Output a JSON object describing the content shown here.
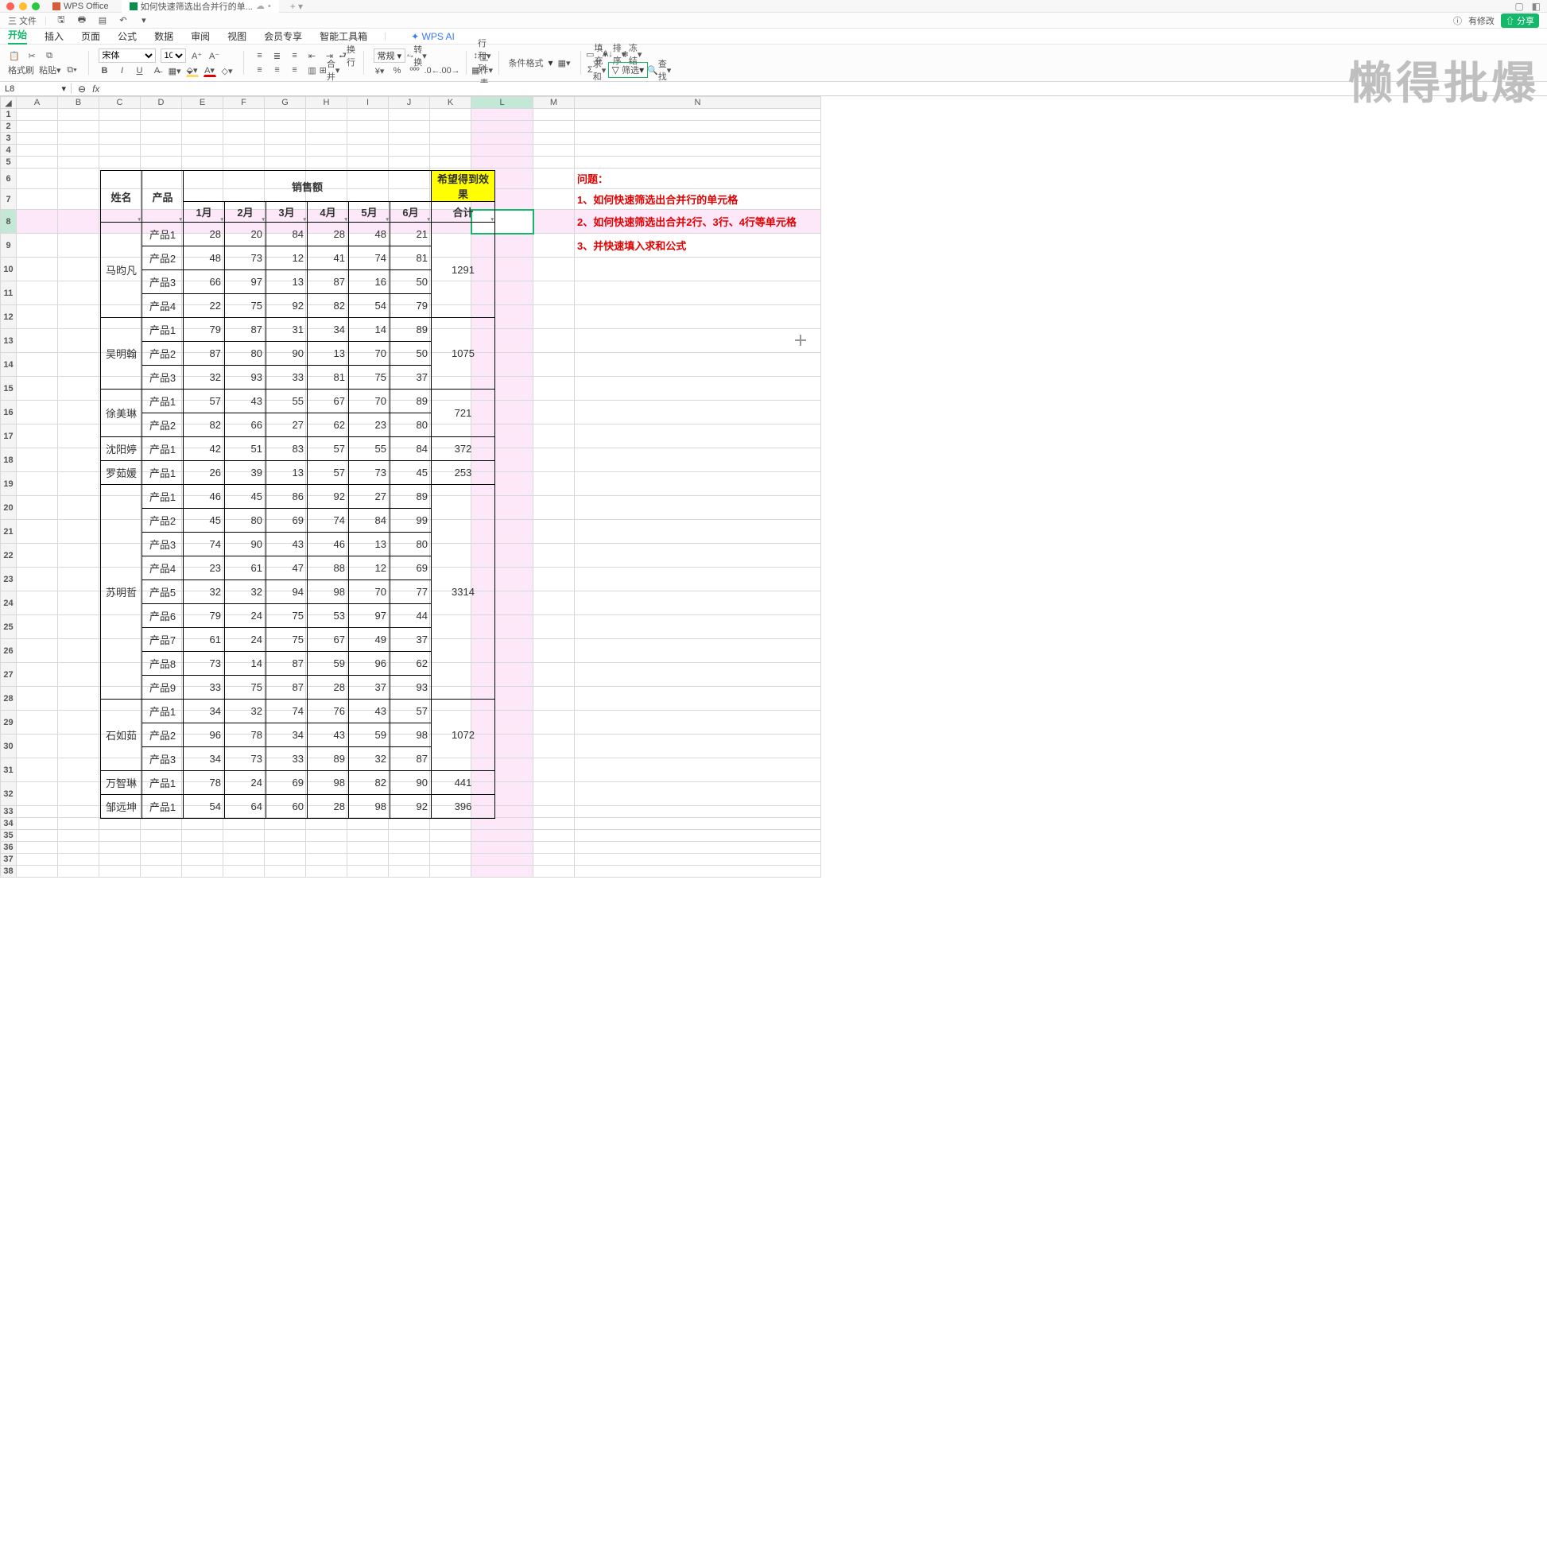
{
  "titlebar": {
    "tab1": "WPS Office",
    "tab2": "如何快速筛选出合并行的单..."
  },
  "filebar": {
    "menu": "三 文件",
    "changes": "有修改",
    "share": "分享"
  },
  "menubar": [
    "开始",
    "插入",
    "页面",
    "公式",
    "数据",
    "审阅",
    "视图",
    "会员专享",
    "智能工具箱"
  ],
  "ai": "WPS AI",
  "ribbon": {
    "fmt_brush": "格式刷",
    "paste": "粘贴",
    "font": "宋体",
    "size": "10",
    "general": "常规",
    "convert": "转换",
    "rowcol": "行和列",
    "sheet": "工作表",
    "cond": "条件格式",
    "fill": "填充",
    "sort": "排序",
    "freeze": "冻结",
    "sum": "求和",
    "filter": "筛选",
    "find": "查找",
    "wrap": "换行",
    "merge": "合并"
  },
  "fbar": {
    "name": "L8",
    "fx": "fx"
  },
  "cols": [
    "A",
    "B",
    "C",
    "D",
    "E",
    "F",
    "G",
    "H",
    "I",
    "J",
    "K",
    "L",
    "M",
    "N"
  ],
  "headers": {
    "name": "姓名",
    "product": "产品",
    "sales": "销售额",
    "expect": "希望得到效果",
    "m1": "1月",
    "m2": "2月",
    "m3": "3月",
    "m4": "4月",
    "m5": "5月",
    "m6": "6月",
    "total": "合计"
  },
  "notes": {
    "title": "问题：",
    "l1": "1、如何快速筛选出合并行的单元格",
    "l2": "2、如何快速筛选出合并2行、3行、4行等单元格",
    "l3": "3、并快速填入求和公式"
  },
  "watermark": "懒得批爆",
  "data": [
    {
      "name": "马昀凡",
      "rows": [
        {
          "p": "产品1",
          "v": [
            28,
            20,
            84,
            28,
            48,
            21
          ]
        },
        {
          "p": "产品2",
          "v": [
            48,
            73,
            12,
            41,
            74,
            81
          ]
        },
        {
          "p": "产品3",
          "v": [
            66,
            97,
            13,
            87,
            16,
            50
          ]
        },
        {
          "p": "产品4",
          "v": [
            22,
            75,
            92,
            82,
            54,
            79
          ]
        }
      ],
      "sum": 1291
    },
    {
      "name": "吴明翰",
      "rows": [
        {
          "p": "产品1",
          "v": [
            79,
            87,
            31,
            34,
            14,
            89
          ]
        },
        {
          "p": "产品2",
          "v": [
            87,
            80,
            90,
            13,
            70,
            50
          ]
        },
        {
          "p": "产品3",
          "v": [
            32,
            93,
            33,
            81,
            75,
            37
          ]
        }
      ],
      "sum": 1075
    },
    {
      "name": "徐美琳",
      "rows": [
        {
          "p": "产品1",
          "v": [
            57,
            43,
            55,
            67,
            70,
            89
          ]
        },
        {
          "p": "产品2",
          "v": [
            82,
            66,
            27,
            62,
            23,
            80
          ]
        }
      ],
      "sum": 721
    },
    {
      "name": "沈阳婷",
      "rows": [
        {
          "p": "产品1",
          "v": [
            42,
            51,
            83,
            57,
            55,
            84
          ]
        }
      ],
      "sum": 372
    },
    {
      "name": "罗茹媛",
      "rows": [
        {
          "p": "产品1",
          "v": [
            26,
            39,
            13,
            57,
            73,
            45
          ]
        }
      ],
      "sum": 253
    },
    {
      "name": "苏明哲",
      "rows": [
        {
          "p": "产品1",
          "v": [
            46,
            45,
            86,
            92,
            27,
            89
          ]
        },
        {
          "p": "产品2",
          "v": [
            45,
            80,
            69,
            74,
            84,
            99
          ]
        },
        {
          "p": "产品3",
          "v": [
            74,
            90,
            43,
            46,
            13,
            80
          ]
        },
        {
          "p": "产品4",
          "v": [
            23,
            61,
            47,
            88,
            12,
            69
          ]
        },
        {
          "p": "产品5",
          "v": [
            32,
            32,
            94,
            98,
            70,
            77
          ]
        },
        {
          "p": "产品6",
          "v": [
            79,
            24,
            75,
            53,
            97,
            44
          ]
        },
        {
          "p": "产品7",
          "v": [
            61,
            24,
            75,
            67,
            49,
            37
          ]
        },
        {
          "p": "产品8",
          "v": [
            73,
            14,
            87,
            59,
            96,
            62
          ]
        },
        {
          "p": "产品9",
          "v": [
            33,
            75,
            87,
            28,
            37,
            93
          ]
        }
      ],
      "sum": 3314
    },
    {
      "name": "石如茹",
      "rows": [
        {
          "p": "产品1",
          "v": [
            34,
            32,
            74,
            76,
            43,
            57
          ]
        },
        {
          "p": "产品2",
          "v": [
            96,
            78,
            34,
            43,
            59,
            98
          ]
        },
        {
          "p": "产品3",
          "v": [
            34,
            73,
            33,
            89,
            32,
            87
          ]
        }
      ],
      "sum": 1072
    },
    {
      "name": "万智琳",
      "rows": [
        {
          "p": "产品1",
          "v": [
            78,
            24,
            69,
            98,
            82,
            90
          ]
        }
      ],
      "sum": 441
    },
    {
      "name": "邹远坤",
      "rows": [
        {
          "p": "产品1",
          "v": [
            54,
            64,
            60,
            28,
            98,
            92
          ]
        }
      ],
      "sum": 396
    }
  ]
}
